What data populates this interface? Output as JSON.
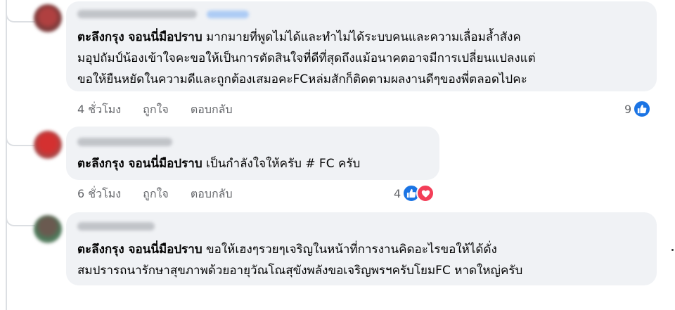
{
  "comments": [
    {
      "author": "ตะลึงกรุง จอนนี่มือปราบ",
      "text_lines": [
        "มากมายที่พูดไม่ได้และทำไม่ได้ระบบคนและความเลื่อมล้ำสังค",
        "มอุปถัมป์น้องเข้าใจคะขอให้เป็นการตัดสินใจที่ดีที่สุดถึงแม้อนาคตอาจมีการเปลี่ยนแปลงแต่",
        "ขอให้ยืนหยัดในความดีและถูกต้องเสมอคะFCหล่มสักก็ติดตามผลงานดีๆของพี่ตลอดไปคะ"
      ],
      "time": "4 ชั่วโมง",
      "like_label": "ถูกใจ",
      "reply_label": "ตอบกลับ",
      "reaction_count": "9",
      "reaction_icons": [
        "like-icon"
      ]
    },
    {
      "author": "ตะลึงกรุง จอนนี่มือปราบ",
      "text_lines": [
        "เป็นกำลังใจให้ครับ # FC ครับ"
      ],
      "time": "6 ชั่วโมง",
      "like_label": "ถูกใจ",
      "reply_label": "ตอบกลับ",
      "reaction_count": "4",
      "reaction_icons": [
        "like-icon",
        "love-icon"
      ]
    },
    {
      "author": "ตะลึงกรุง จอนนี่มือปราบ",
      "text_lines": [
        "ขอให้เฮงๆรวยๆเจริญในหน้าที่การงานคิดอะไรขอให้ได้ดั่ง",
        "สมปรารถนารักษาสุขภาพด้วยอายุวัณโณสุขังพลังขอเจริญพรฯครับโยมFC หาดใหญ่ครับ"
      ]
    }
  ],
  "colors": {
    "bubble": "#f0f2f5",
    "meta_text": "#65676b",
    "like_blue": "#1b74e4",
    "love_red": "#f33e58"
  }
}
